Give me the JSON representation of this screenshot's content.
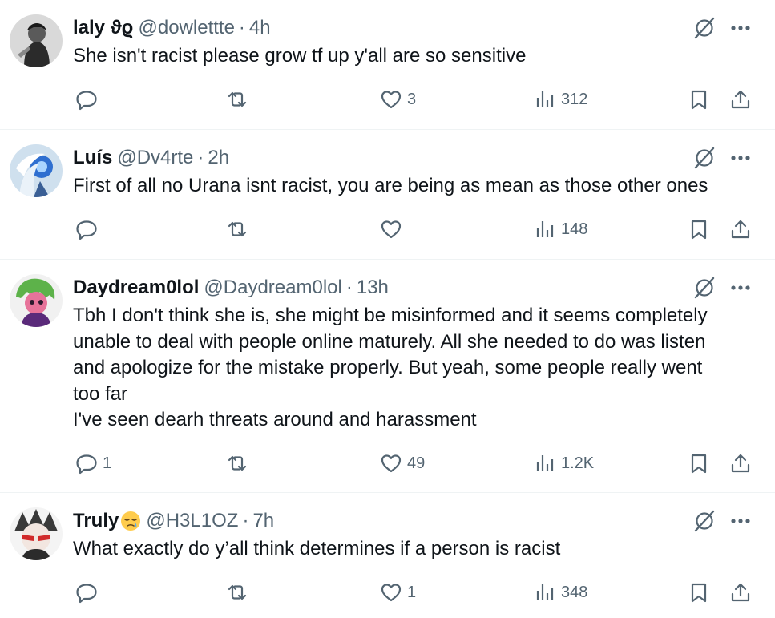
{
  "tweets": [
    {
      "name": "laly ϑϱ",
      "handle": "@dowlettte",
      "separator": "·",
      "time": "4h",
      "lines": [
        "She isn't racist please grow tf up y'all are so sensitive"
      ],
      "replies": "",
      "likes": "3",
      "views": "312"
    },
    {
      "name": "Luís",
      "handle": "@Dv4rte",
      "separator": "·",
      "time": "2h",
      "lines": [
        "First of all no Urana isnt racist, you are being as mean as those other ones"
      ],
      "replies": "",
      "likes": "",
      "views": "148"
    },
    {
      "name": "Daydream0lol",
      "handle": "@Daydream0lol",
      "separator": "·",
      "time": "13h",
      "lines": [
        "Tbh I don't think she is, she might be misinformed and it seems completely",
        "unable to deal with people online maturely. All she needed to do was listen",
        "and apologize for the mistake properly. But yeah, some people really went",
        "too far",
        "I've seen dearh threats around and harassment"
      ],
      "replies": "1",
      "likes": "49",
      "views": "1.2K"
    },
    {
      "name": "Truly",
      "handle": "@H3L1OZ",
      "separator": "·",
      "time": "7h",
      "name_emoji": "sleepy-face-emoji",
      "lines": [
        "What exactly do y’all think determines if a person is racist"
      ],
      "replies": "",
      "likes": "1",
      "views": "348"
    }
  ],
  "icons": {
    "reply": "reply-icon",
    "retweet": "retweet-icon",
    "like": "heart-icon",
    "views": "views-chart-icon",
    "bookmark": "bookmark-icon",
    "share": "share-icon",
    "grok": "grok-icon",
    "more": "more-options-icon"
  },
  "colors": {
    "text": "#0f1419",
    "secondary": "#536471",
    "divider": "#eff3f4"
  }
}
